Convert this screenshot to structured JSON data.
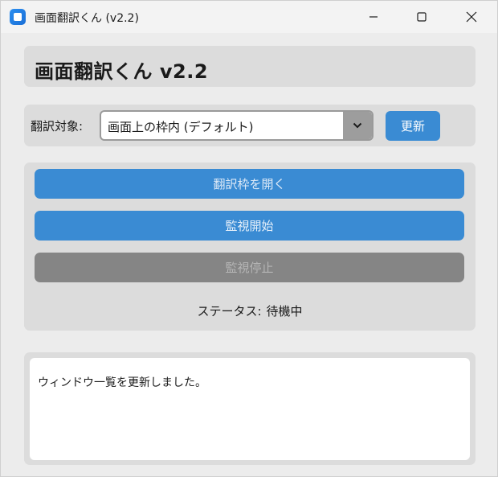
{
  "window": {
    "title": "画面翻訳くん (v2.2)"
  },
  "header": {
    "heading": "画面翻訳くん v2.2"
  },
  "target": {
    "label": "翻訳対象:",
    "selected": "画面上の枠内 (デフォルト)",
    "refresh_label": "更新"
  },
  "actions": {
    "open_frame_label": "翻訳枠を開く",
    "start_label": "監視開始",
    "stop_label": "監視停止",
    "status_label": "ステータス:",
    "status_value": "待機中"
  },
  "log": {
    "text": "ウィンドウ一覧を更新しました。"
  },
  "colors": {
    "accent": "#3a8bd3",
    "disabled": "#858585",
    "panel": "#dcdcdc"
  }
}
